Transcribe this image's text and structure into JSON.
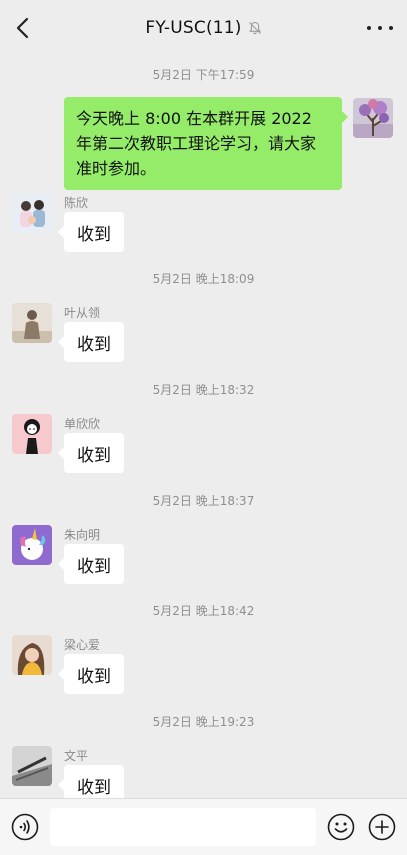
{
  "header": {
    "title": "FY-USC(11)",
    "back_icon": "chevron-left-icon",
    "mute_icon": "bell-off-icon",
    "more_icon": "more-dots-icon"
  },
  "messages": [
    {
      "timestamp": "5月2日 下午17:59"
    },
    {
      "outgoing_text": "今天晚上 8:00 在本群开展 2022 年第二次教职工理论学习，请大家准时参加。"
    },
    {
      "sender": "陈欣",
      "text": "收到"
    },
    {
      "timestamp": "5月2日 晚上18:09"
    },
    {
      "sender": "叶从领",
      "text": "收到"
    },
    {
      "timestamp": "5月2日 晚上18:32"
    },
    {
      "sender": "单欣欣",
      "text": "收到"
    },
    {
      "timestamp": "5月2日 晚上18:37"
    },
    {
      "sender": "朱向明",
      "text": "收到"
    },
    {
      "timestamp": "5月2日 晚上18:42"
    },
    {
      "sender": "梁心爱",
      "text": "收到"
    },
    {
      "timestamp": "5月2日 晚上19:23"
    },
    {
      "sender": "文平",
      "text": "收到"
    }
  ],
  "footer": {
    "input_value": "",
    "voice_icon": "voice-icon",
    "emoji_icon": "emoji-icon",
    "plus_icon": "plus-icon"
  },
  "colors": {
    "background": "#ededed",
    "outgoing_bubble": "#95ec69",
    "incoming_bubble": "#ffffff",
    "muted_text": "#8f8f8f"
  }
}
